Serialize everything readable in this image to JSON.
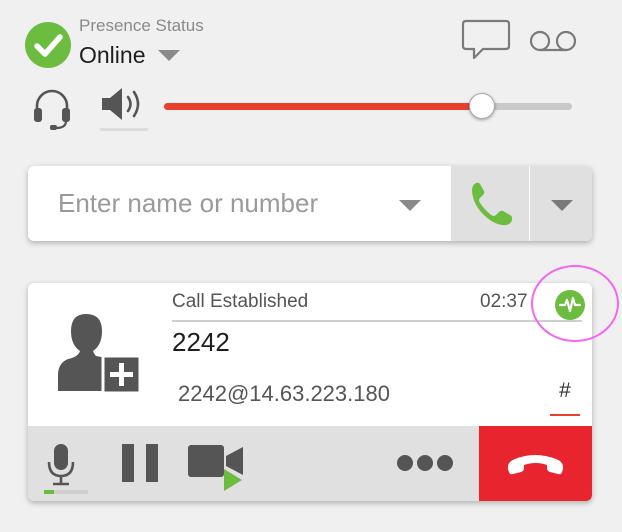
{
  "presence": {
    "label": "Presence Status",
    "value": "Online"
  },
  "icons": {
    "status": "checkmark-icon",
    "chat": "chat-bubble-icon",
    "voicemail": "voicemail-icon",
    "headset": "headset-icon",
    "speaker": "speaker-icon",
    "call": "phone-icon",
    "avatar": "add-contact-icon",
    "quality": "call-quality-icon",
    "mute": "microphone-icon",
    "hold": "pause-icon",
    "video": "video-camera-icon",
    "more": "more-dots-icon",
    "hangup": "hang-up-icon"
  },
  "volume": {
    "level": 0.78
  },
  "dial": {
    "placeholder": "Enter name or number",
    "value": ""
  },
  "call": {
    "status": "Call Established",
    "timer": "02:37",
    "number": "2242",
    "sip_address": "2242@14.63.223.180",
    "dtmf_label": "#",
    "mic_level": 0.22
  },
  "colors": {
    "accent_green": "#6cbc3f",
    "accent_red": "#e8402c",
    "hangup_red": "#e8252f",
    "highlight_pink": "#f267ee"
  }
}
